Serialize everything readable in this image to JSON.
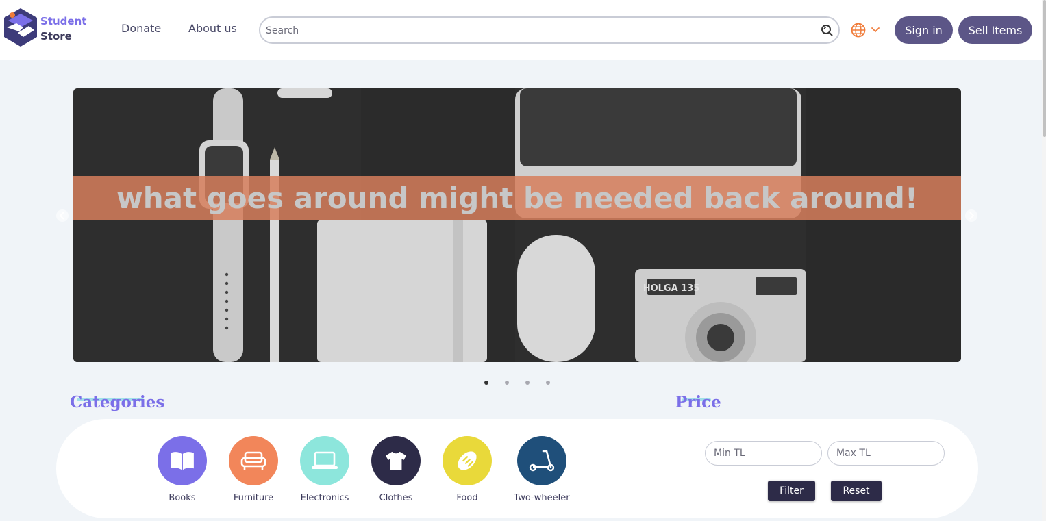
{
  "brand": {
    "name_line1": "Student",
    "name_line2": "Store",
    "accent": "#7b6fe8",
    "primary": "#5c5687"
  },
  "nav": {
    "donate": "Donate",
    "about": "About us"
  },
  "search": {
    "placeholder": "Search",
    "icon": "search-icon"
  },
  "language": {
    "icon": "globe-icon",
    "dropdown_icon": "chevron-down-icon",
    "color": "#f07c3a"
  },
  "auth": {
    "sign_in": "Sign in",
    "sell_items": "Sell Items"
  },
  "carousel": {
    "slogan": "what goes around might be needed back around!",
    "camera_label": "HOLGA 135",
    "slide_count": 4,
    "active_slide": 1
  },
  "categories": {
    "title": "Categories",
    "items": [
      {
        "label": "Books",
        "icon": "book-icon",
        "color": "#7b6fe8"
      },
      {
        "label": "Furniture",
        "icon": "sofa-icon",
        "color": "#f2865a"
      },
      {
        "label": "Electronics",
        "icon": "laptop-icon",
        "color": "#8de6dc"
      },
      {
        "label": "Clothes",
        "icon": "tshirt-icon",
        "color": "#2d2b48"
      },
      {
        "label": "Food",
        "icon": "bread-icon",
        "color": "#e9d93a"
      },
      {
        "label": "Two-wheeler",
        "icon": "scooter-icon",
        "color": "#1f4f7a"
      }
    ]
  },
  "price": {
    "title": "Price",
    "min_placeholder": "Min TL",
    "max_placeholder": "Max TL",
    "filter_label": "Filter",
    "reset_label": "Reset"
  }
}
